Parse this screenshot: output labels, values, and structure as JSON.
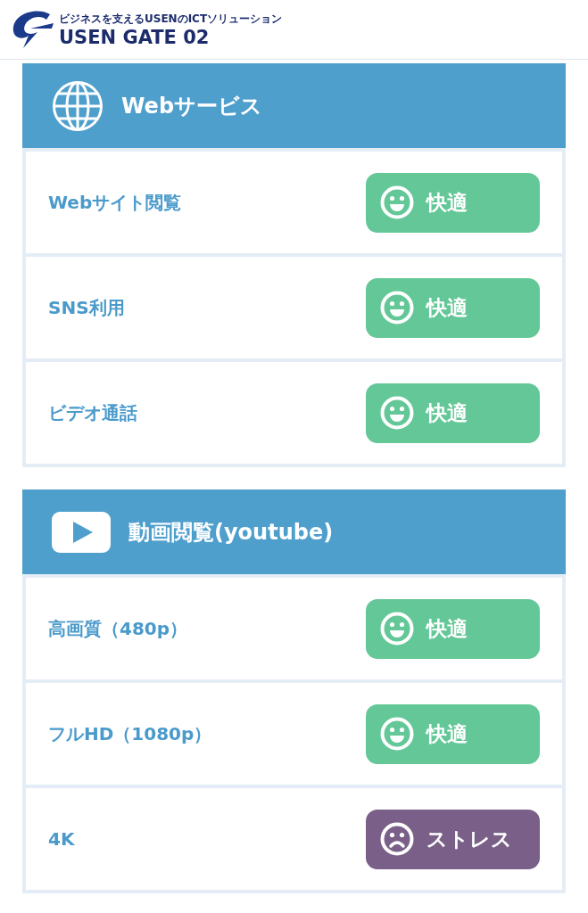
{
  "header": {
    "tagline": "ビジネスを支えるUSENのICTソリューション",
    "brand": "USEN GATE 02"
  },
  "sections": [
    {
      "title": "Webサービス",
      "kind": "globe",
      "rows": [
        {
          "label": "Webサイト閲覧",
          "status": "快適",
          "kind": "good"
        },
        {
          "label": "SNS利用",
          "status": "快適",
          "kind": "good"
        },
        {
          "label": "ビデオ通話",
          "status": "快適",
          "kind": "good"
        }
      ]
    },
    {
      "title": "動画閲覧(youtube)",
      "kind": "video",
      "rows": [
        {
          "label": "高画質（480p）",
          "status": "快適",
          "kind": "good"
        },
        {
          "label": "フルHD（1080p）",
          "status": "快適",
          "kind": "good"
        },
        {
          "label": "4K",
          "status": "ストレス",
          "kind": "bad"
        }
      ]
    }
  ]
}
